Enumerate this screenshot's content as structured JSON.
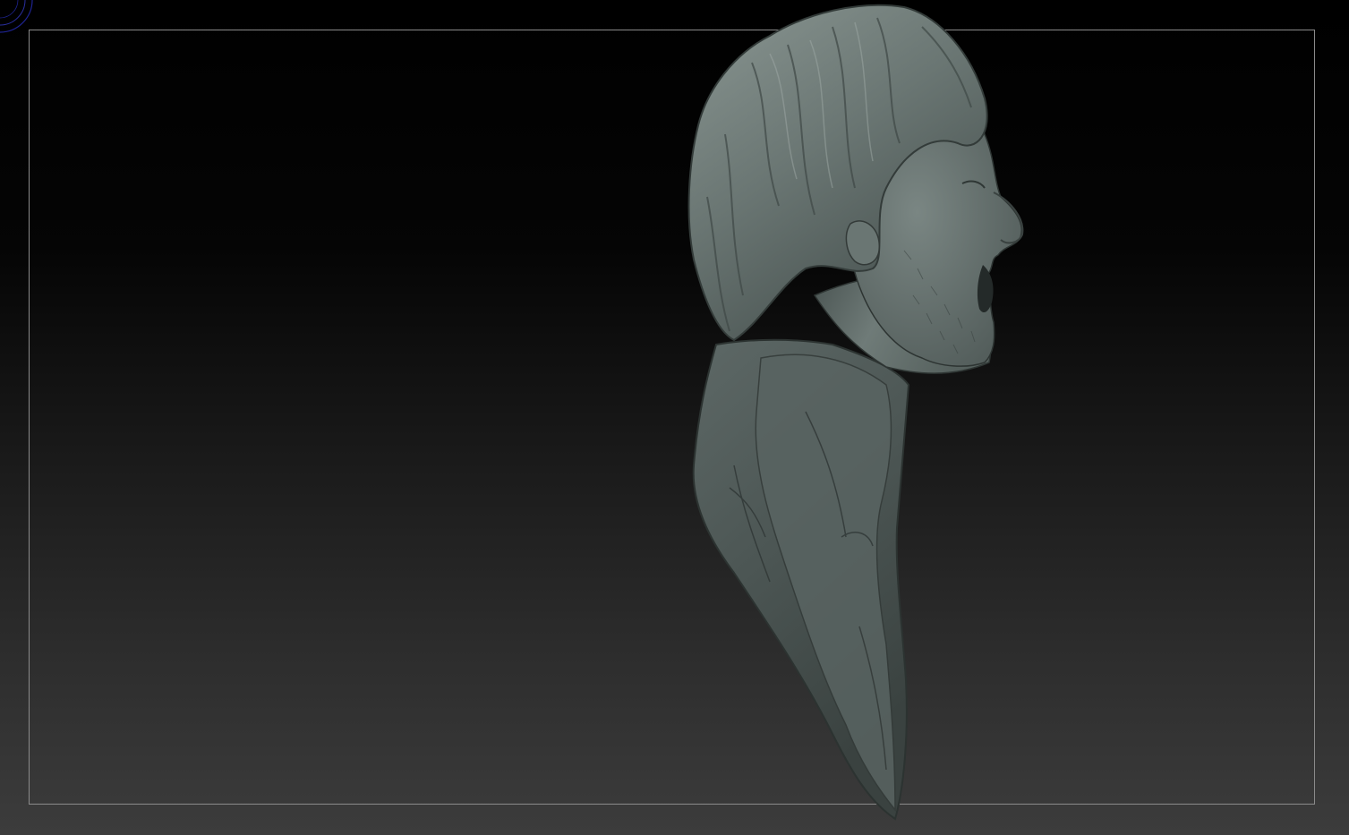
{
  "app": {
    "view": "3D viewport",
    "model_icon": "sculpted-bust-profile"
  },
  "colors": {
    "background_top": "#000000",
    "background_bottom": "#3c3c3c",
    "frame_border": "#8a8a8a",
    "model_base": "#5f6a67",
    "model_highlight": "#8c9894",
    "model_shadow": "#2b3130",
    "gizmo": "#2a2fa0"
  }
}
